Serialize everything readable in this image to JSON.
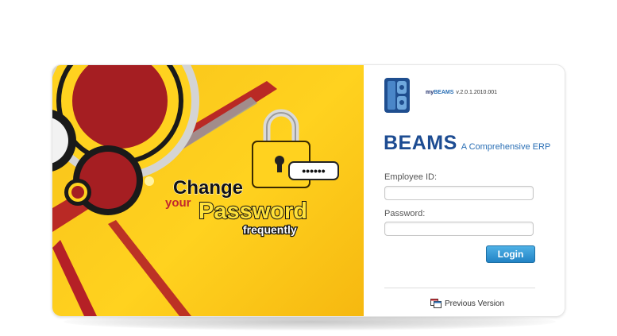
{
  "banner": {
    "line1": "Change",
    "line2": "your",
    "line3": "Password",
    "line4": "frequently",
    "password_mask": "••••••",
    "colors": {
      "background": "#ffc81a",
      "dark_red": "#a51e22",
      "text_white": "#ffffff",
      "text_red": "#c1272d",
      "text_black": "#111111"
    }
  },
  "app": {
    "product_prefix": "my",
    "product_name": "BEAMS",
    "version": "v.2.0.1.2010.001",
    "brand_name": "BEAMS",
    "brand_tagline": "A Comprehensive ERP"
  },
  "form": {
    "employee_label": "Employee ID:",
    "employee_value": "",
    "password_label": "Password:",
    "password_value": "",
    "login_label": "Login"
  },
  "footer": {
    "previous_version_label": "Previous Version"
  },
  "colors": {
    "brand_blue": "#1d4c92",
    "accent_blue": "#2a83c5"
  }
}
